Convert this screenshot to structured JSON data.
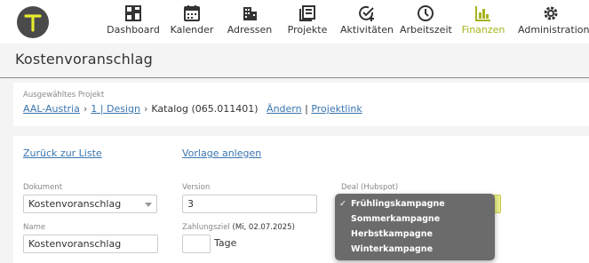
{
  "nav": {
    "logo_letter": "T",
    "items": [
      {
        "label": "Dashboard",
        "icon": "dashboard-icon"
      },
      {
        "label": "Kalender",
        "icon": "calendar-icon"
      },
      {
        "label": "Adressen",
        "icon": "building-icon"
      },
      {
        "label": "Projekte",
        "icon": "projects-icon"
      },
      {
        "label": "Aktivitäten",
        "icon": "activities-icon"
      },
      {
        "label": "Arbeitszeit",
        "icon": "clock-icon"
      },
      {
        "label": "Finanzen",
        "icon": "finance-chart-icon",
        "active": true
      },
      {
        "label": "Administration",
        "icon": "gear-icon"
      }
    ],
    "accent_color": "#a6b41c"
  },
  "page": {
    "title": "Kostenvoranschlag"
  },
  "project": {
    "caption": "Ausgewähltes Projekt",
    "crumb1": "AAL-Austria",
    "crumb2": "1 | Design",
    "catalog": "Katalog (065.011401)",
    "change_link": "Ändern",
    "divider": "|",
    "project_link": "Projektlink"
  },
  "form": {
    "back_link": "Zurück zur Liste",
    "template_link": "Vorlage anlegen",
    "document_label": "Dokument",
    "document_value": "Kostenvoranschlag",
    "version_label": "Version",
    "version_value": "3",
    "deal_label": "Deal (Hubspot)",
    "name_label": "Name",
    "name_value": "Kostenvoranschlag",
    "payment_label": "Zahlungsziel",
    "payment_hint": "(Mi, 02.07.2025)",
    "payment_value": "",
    "days_unit": "Tage"
  },
  "deal_menu": {
    "options": [
      "Frühlingskampagne",
      "Sommerkampagne",
      "Herbstkampagne",
      "Winterkampagne"
    ],
    "selected_index": 0,
    "check_glyph": "✓"
  }
}
